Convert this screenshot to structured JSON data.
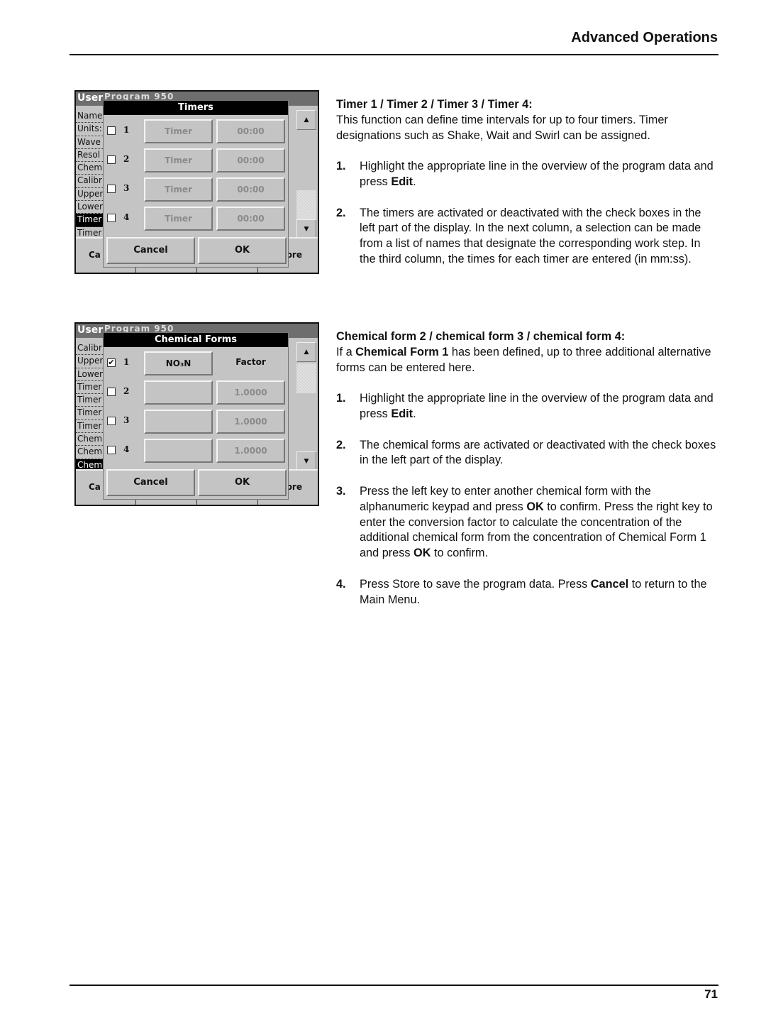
{
  "header": {
    "title": "Advanced Operations"
  },
  "footer": {
    "page_number": "71"
  },
  "screens": {
    "timers": {
      "title_visible": "User",
      "title_obscured": "Program   950",
      "list": [
        "Name",
        "Units:",
        "Wave",
        "Resol",
        "Chem",
        "Calibr",
        "Upper",
        "Lower",
        "Timer",
        "Timer"
      ],
      "selected_index": 8,
      "scroll_position": 0.75,
      "dialog": {
        "title": "Timers",
        "rows": [
          {
            "checked": false,
            "number": "1",
            "left": "Timer",
            "right": "00:00"
          },
          {
            "checked": false,
            "number": "2",
            "left": "Timer",
            "right": "00:00"
          },
          {
            "checked": false,
            "number": "3",
            "left": "Timer",
            "right": "00:00"
          },
          {
            "checked": false,
            "number": "4",
            "left": "Timer",
            "right": "00:00"
          }
        ],
        "cancel": "Cancel",
        "ok": "OK"
      },
      "bottom_left": "Ca",
      "bottom_right": "ore"
    },
    "chemforms": {
      "title_visible": "User",
      "title_obscured": "Program   950",
      "list": [
        "Calibr",
        "Upper",
        "Lower",
        "Timer",
        "Timer",
        "Timer",
        "Timer",
        "Chem",
        "Chem",
        "Chem"
      ],
      "selected_index": 9,
      "scroll_position": 0.25,
      "dialog": {
        "title": "Chemical Forms",
        "rows": [
          {
            "checked": true,
            "number": "1",
            "left": "NO₃N",
            "right": "Factor"
          },
          {
            "checked": false,
            "number": "2",
            "left": "",
            "right": "1.0000"
          },
          {
            "checked": false,
            "number": "3",
            "left": "",
            "right": "1.0000"
          },
          {
            "checked": false,
            "number": "4",
            "left": "",
            "right": "1.0000"
          }
        ],
        "cancel": "Cancel",
        "ok": "OK"
      },
      "bottom_left": "Ca",
      "bottom_right": "ore"
    }
  },
  "sections": {
    "timers": {
      "heading": "Timer 1 / Timer 2 / Timer 3 / Timer 4:",
      "intro": "This function can define time intervals for up to four timers. Timer designations such as Shake, Wait and Swirl can be assigned.",
      "steps": [
        {
          "n": "1.",
          "a": "Highlight the appropriate line in the overview of the program data and press ",
          "b": "Edit",
          "c": "."
        },
        {
          "n": "2.",
          "a": "The timers are activated or deactivated with the check boxes in the left part of the display. In the next column, a selection can be made from a list of names that designate the corresponding work step. In the third column, the times for each timer are entered (in mm:ss).",
          "b": "",
          "c": ""
        }
      ]
    },
    "chemforms": {
      "heading": "Chemical form 2 / chemical form 3 / chemical form 4:",
      "intro_a": "If a ",
      "intro_b": "Chemical Form 1",
      "intro_c": " has been defined, up to three additional alternative forms can be entered here.",
      "steps": [
        {
          "n": "1.",
          "parts": [
            "Highlight the appropriate line in the overview of the program data and press ",
            "Edit",
            "."
          ]
        },
        {
          "n": "2.",
          "parts": [
            "The chemical forms are activated or deactivated with the check boxes in the left part of the display.",
            "",
            ""
          ]
        },
        {
          "n": "3.",
          "parts": [
            "Press the left key to enter another chemical form with the alphanumeric keypad and press ",
            "OK",
            " to confirm. Press the right key to enter the conversion factor to calculate the concentration of the additional chemical form from the concentration of Chemical Form 1 and press ",
            "OK",
            " to confirm."
          ]
        },
        {
          "n": "4.",
          "parts": [
            "Press Store to save the program data. Press ",
            "Cancel",
            " to return to the Main Menu."
          ]
        }
      ]
    }
  }
}
